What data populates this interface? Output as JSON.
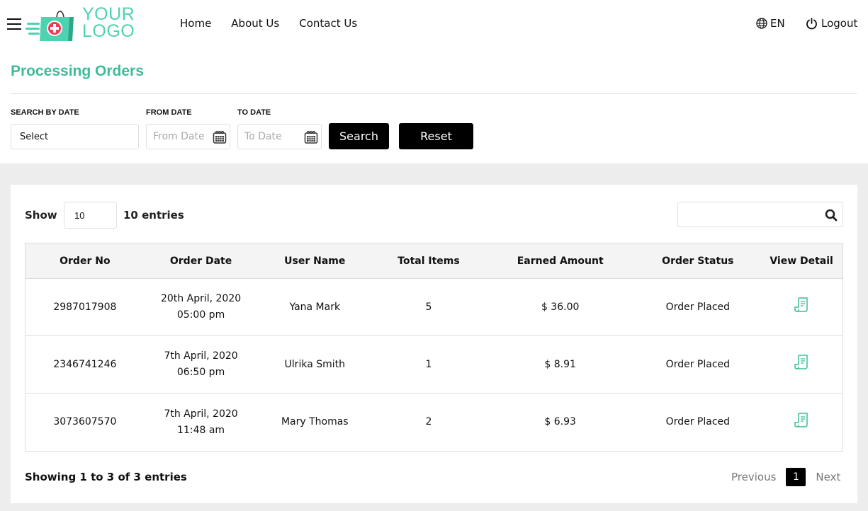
{
  "header": {
    "logo": {
      "line1": "YOUR",
      "line2": "LOGO"
    },
    "nav": [
      {
        "label": "Home"
      },
      {
        "label": "About Us"
      },
      {
        "label": "Contact Us"
      }
    ],
    "language": "EN",
    "logout_label": "Logout"
  },
  "page": {
    "title": "Processing Orders"
  },
  "filters": {
    "search_by_date_label": "SEARCH BY DATE",
    "search_by_date_value": "Select",
    "from_date_label": "FROM DATE",
    "from_date_placeholder": "From Date",
    "to_date_label": "TO DATE",
    "to_date_placeholder": "To Date",
    "search_button": "Search",
    "reset_button": "Reset"
  },
  "table_controls": {
    "show_label": "Show",
    "page_size": "10",
    "entries_label": "10 entries",
    "search_value": ""
  },
  "table": {
    "columns": [
      "Order No",
      "Order Date",
      "User Name",
      "Total Items",
      "Earned Amount",
      "Order Status",
      "View Detail"
    ],
    "rows": [
      {
        "order_no": "2987017908",
        "date": "20th April, 2020",
        "time": "05:00 pm",
        "user": "Yana Mark",
        "items": "5",
        "amount": "$ 36.00",
        "status": "Order Placed"
      },
      {
        "order_no": "2346741246",
        "date": "7th April, 2020",
        "time": "06:50 pm",
        "user": "Ulrika Smith",
        "items": "1",
        "amount": "$ 8.91",
        "status": "Order Placed"
      },
      {
        "order_no": "3073607570",
        "date": "7th April, 2020",
        "time": "11:48 am",
        "user": "Mary Thomas",
        "items": "2",
        "amount": "$ 6.93",
        "status": "Order Placed"
      }
    ]
  },
  "footer": {
    "showing": "Showing 1 to 3 of 3 entries",
    "previous": "Previous",
    "current_page": "1",
    "next": "Next"
  },
  "colors": {
    "accent": "#3dbd98",
    "logo": "#4dd3b0",
    "button": "#000000"
  }
}
